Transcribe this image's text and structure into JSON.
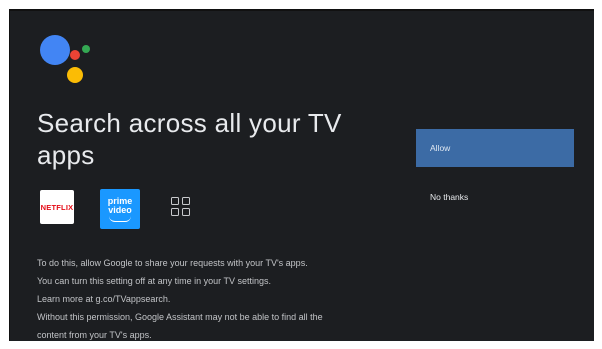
{
  "dialog": {
    "title": "Search across all your TV apps",
    "apps": [
      {
        "name": "Netflix",
        "label": "NETFLIX",
        "icon": "netflix-logo"
      },
      {
        "name": "Prime Video",
        "label_line1": "prime",
        "label_line2": "video",
        "icon": "prime-video-logo"
      },
      {
        "name": "More apps",
        "icon": "apps-grid-icon"
      }
    ],
    "paragraphs": [
      "To do this, allow Google to share your requests with your TV's apps.",
      "You can turn this setting off at any time in your TV settings.",
      "Learn more at g.co/TVappsearch.",
      "Without this permission, Google Assistant may not be able to find all the",
      "content from your TV's apps."
    ],
    "buttons": {
      "allow": "Allow",
      "no_thanks": "No thanks"
    }
  },
  "colors": {
    "background": "#1c1e21",
    "accent_button": "#3c6ba5",
    "google_blue": "#4285f4",
    "google_red": "#ea4335",
    "google_yellow": "#fbbc05",
    "google_green": "#34a853"
  }
}
